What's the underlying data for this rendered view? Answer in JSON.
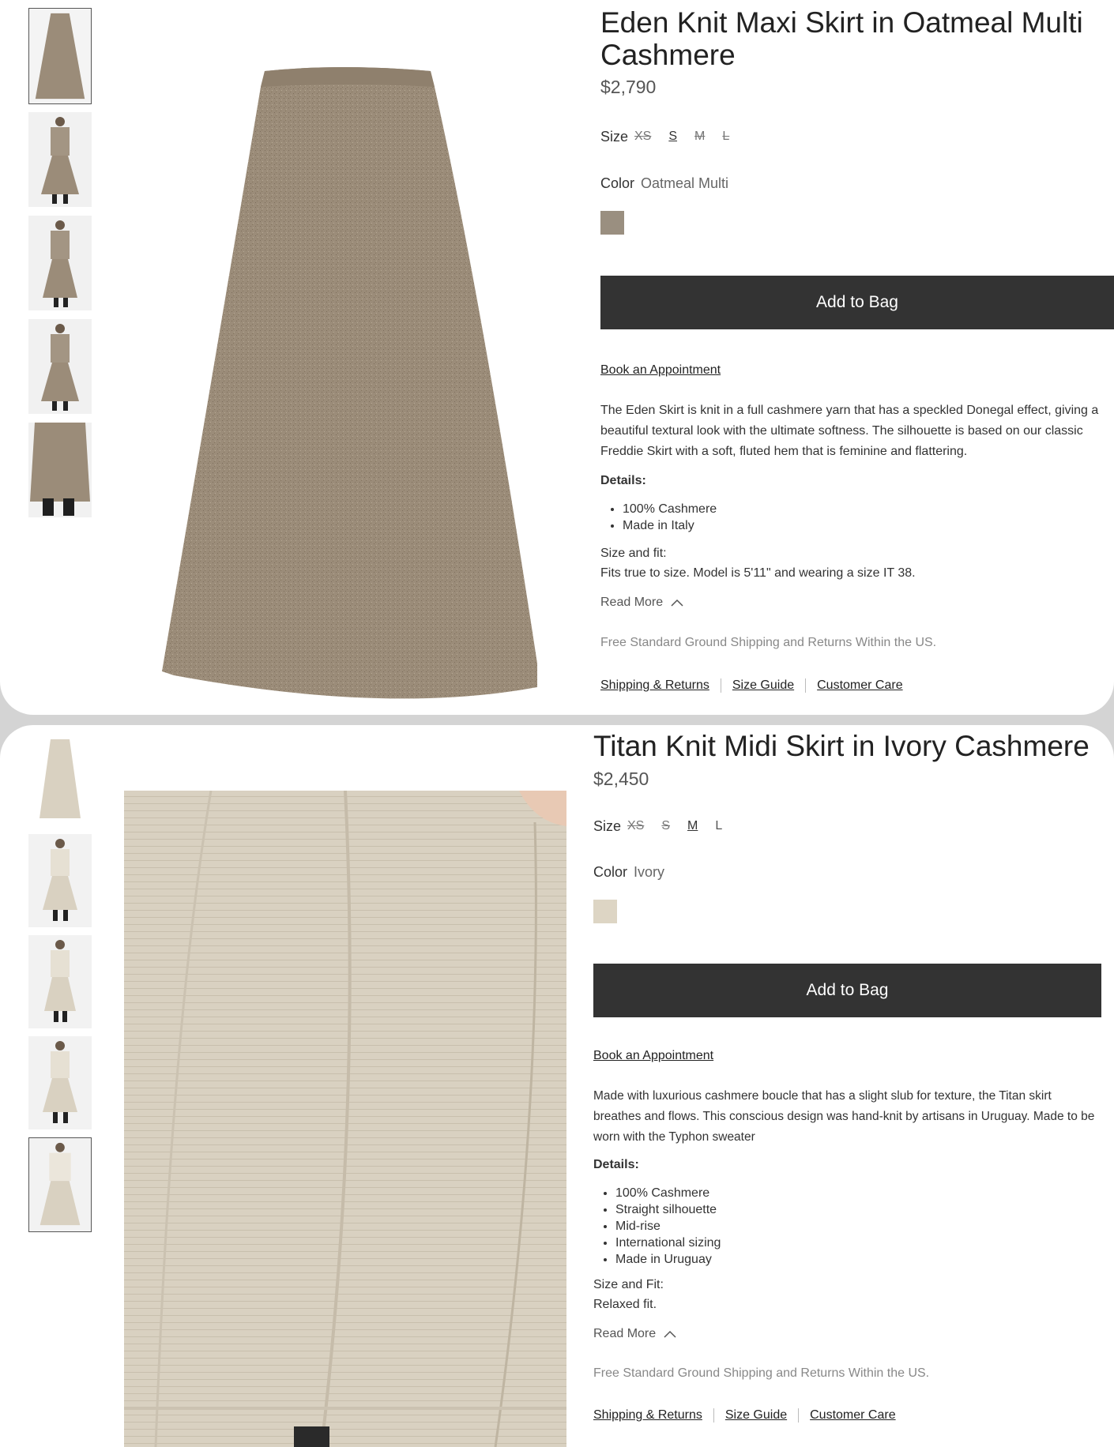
{
  "product1": {
    "title": "Eden Knit Maxi Skirt in Oatmeal Multi Cashmere",
    "price": "$2,790",
    "size_label": "Size",
    "sizes": [
      "XS",
      "S",
      "M",
      "L"
    ],
    "color_label": "Color",
    "color_value": "Oatmeal Multi",
    "swatch_color": "#9a8f80",
    "add_to_bag": "Add to Bag",
    "book_appointment": "Book an Appointment",
    "description": "The Eden Skirt is knit in a full cashmere yarn that has a speckled Donegal effect, giving a beautiful textural look with the ultimate softness. The silhouette is based on our classic Freddie Skirt with a soft, fluted hem that is feminine and flattering.",
    "details_heading": "Details:",
    "details": [
      "100% Cashmere",
      "Made in Italy"
    ],
    "fit_heading": "Size and fit:",
    "fit_text": "Fits true to size. Model is 5'11\" and wearing a size IT 38.",
    "read_more": "Read More",
    "shipping_note": "Free Standard Ground Shipping and Returns Within the US.",
    "links": {
      "shipping": "Shipping & Returns",
      "size_guide": "Size Guide",
      "customer_care": "Customer Care"
    }
  },
  "product2": {
    "title": "Titan Knit Midi Skirt in Ivory Cashmere",
    "price": "$2,450",
    "size_label": "Size",
    "sizes": [
      "XS",
      "S",
      "M",
      "L"
    ],
    "color_label": "Color",
    "color_value": "Ivory",
    "swatch_color": "#ddd5c4",
    "add_to_bag": "Add to Bag",
    "book_appointment": "Book an Appointment",
    "description": "Made with luxurious cashmere boucle that has a slight slub for texture, the Titan skirt breathes and flows. This conscious design was hand-knit by artisans in Uruguay. Made to be worn with the Typhon sweater",
    "details_heading": "Details:",
    "details": [
      "100% Cashmere",
      "Straight silhouette",
      "Mid-rise",
      "International sizing",
      "Made in Uruguay"
    ],
    "fit_heading": "Size and Fit:",
    "fit_text": "Relaxed fit.",
    "read_more": "Read More",
    "shipping_note": "Free Standard Ground Shipping and Returns Within the US.",
    "links": {
      "shipping": "Shipping & Returns",
      "size_guide": "Size Guide",
      "customer_care": "Customer Care"
    }
  },
  "colors": {
    "button_bg": "#333333",
    "skirt_oatmeal": "#9b8c79",
    "skirt_ivory": "#d9d1c1"
  }
}
